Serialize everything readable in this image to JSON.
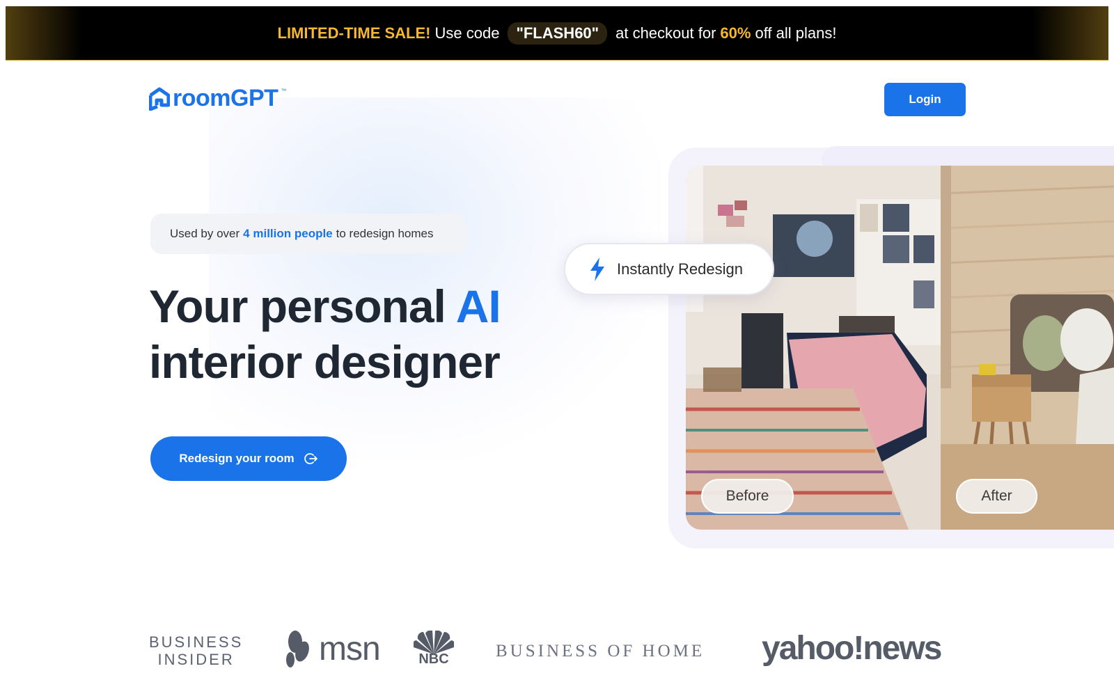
{
  "promo": {
    "sale": "LIMITED-TIME SALE!",
    "use_code": "Use code",
    "code": "\"FLASH60\"",
    "checkout": "at checkout for",
    "percent": "60%",
    "rest": "off all plans!"
  },
  "header": {
    "logo": "roomGPT",
    "logo_tm": "™",
    "login": "Login"
  },
  "hero": {
    "pill_prefix": "Used by over",
    "pill_highlight": "4 million people",
    "pill_suffix": "to redesign homes",
    "headline_1": "Your personal",
    "headline_ai": "AI",
    "headline_2": "interior designer",
    "cta": "Redesign your room",
    "chip": "Instantly Redesign",
    "before": "Before",
    "after": "After"
  },
  "press": {
    "business_insider_1": "BUSINESS",
    "business_insider_2": "INSIDER",
    "msn": "msn",
    "nbc": "NBC",
    "boh": "BUSINESS OF HOME",
    "yahoo": "yahoo!news"
  },
  "colors": {
    "accent": "#1a73e8",
    "promo_gold": "#f5b82e",
    "promo_bg": "#000000"
  }
}
